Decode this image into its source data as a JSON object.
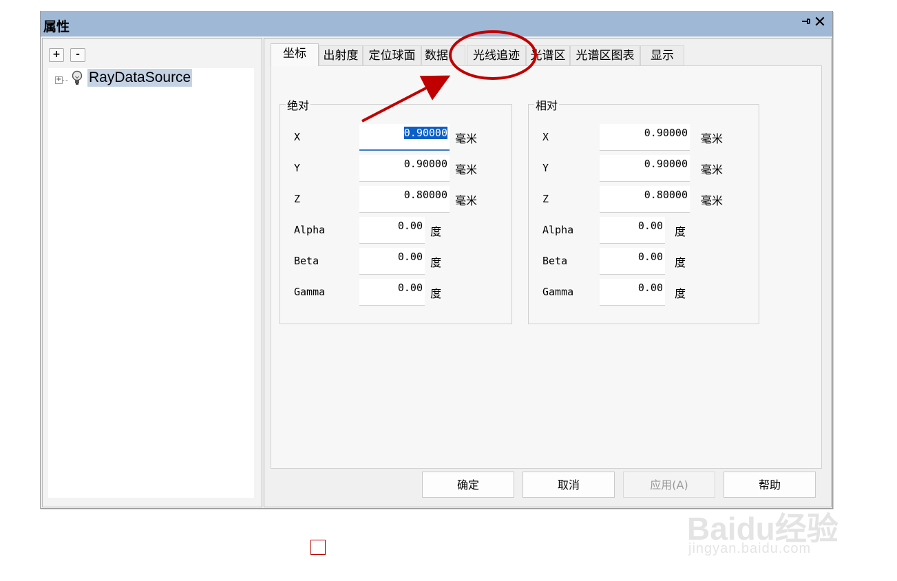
{
  "window": {
    "title": "属性"
  },
  "tree": {
    "expand_label": "+",
    "collapse_label": "-",
    "node_toggle": "+",
    "node_label": "RayDataSource"
  },
  "tabs": [
    {
      "label": "坐标",
      "active": true
    },
    {
      "label": "出射度"
    },
    {
      "label": "定位球面"
    },
    {
      "label": "数据"
    },
    {
      "label": "光线追迹"
    },
    {
      "label": "光谱区"
    },
    {
      "label": "光谱区图表"
    },
    {
      "label": "显示"
    }
  ],
  "absolute": {
    "title": "绝对",
    "fields": [
      {
        "label": "X",
        "value": "0.90000",
        "unit": "毫米"
      },
      {
        "label": "Y",
        "value": "0.90000",
        "unit": "毫米"
      },
      {
        "label": "Z",
        "value": "0.80000",
        "unit": "毫米"
      },
      {
        "label": "Alpha",
        "value": "0.00",
        "unit": "度"
      },
      {
        "label": "Beta",
        "value": "0.00",
        "unit": "度"
      },
      {
        "label": "Gamma",
        "value": "0.00",
        "unit": "度"
      }
    ]
  },
  "relative": {
    "title": "相对",
    "fields": [
      {
        "label": "X",
        "value": "0.90000",
        "unit": "毫米"
      },
      {
        "label": "Y",
        "value": "0.90000",
        "unit": "毫米"
      },
      {
        "label": "Z",
        "value": "0.80000",
        "unit": "毫米"
      },
      {
        "label": "Alpha",
        "value": "0.00",
        "unit": "度"
      },
      {
        "label": "Beta",
        "value": "0.00",
        "unit": "度"
      },
      {
        "label": "Gamma",
        "value": "0.00",
        "unit": "度"
      }
    ]
  },
  "buttons": {
    "ok": "确定",
    "cancel": "取消",
    "apply": "应用(A)",
    "help": "帮助"
  },
  "icons": {
    "pin": "pin-icon",
    "close": "close-icon",
    "bulb": "lightbulb-icon"
  },
  "colors": {
    "titlebar": "#9fb8d6",
    "annotation": "#c00000",
    "selection": "#0a5fc8"
  },
  "watermark": {
    "main": "Baidu经验",
    "sub": "jingyan.baidu.com"
  }
}
